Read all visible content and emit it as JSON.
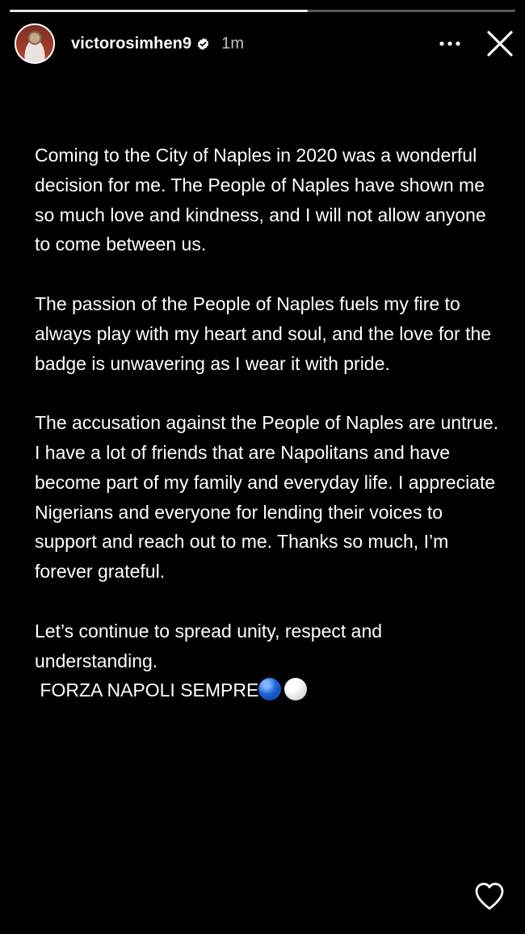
{
  "story": {
    "progress": 0.59,
    "username": "victorosimhen9",
    "verified": true,
    "time_ago": "1m",
    "more_icon": "more-horizontal-icon",
    "close_icon": "close-icon",
    "like_icon": "heart-icon",
    "paragraphs": [
      "Coming to the City of Naples in 2020 was a wonderful decision for me. The People of Naples have shown me so much love and kindness, and I will not allow anyone to come between us.",
      "The passion of the People of Naples fuels my fire to always play with my heart and soul, and the love for the badge is unwavering as I wear it with pride.",
      "The accusation against the People of Naples are untrue. I have a lot of friends that are Napolitans and have become part of my family and everyday life. I appreciate Nigerians and everyone for lending their voices to support and reach out to me. Thanks so much, I’m forever grateful."
    ],
    "closing_line_1": "Let’s continue to spread unity, respect and understanding.",
    "closing_line_2": " FORZA NAPOLI SEMPRE",
    "emoji": [
      "blue-circle",
      "white-circle"
    ]
  },
  "colors": {
    "background": "#000000",
    "text": "#ffffff",
    "verified_badge": "#ffffff"
  }
}
